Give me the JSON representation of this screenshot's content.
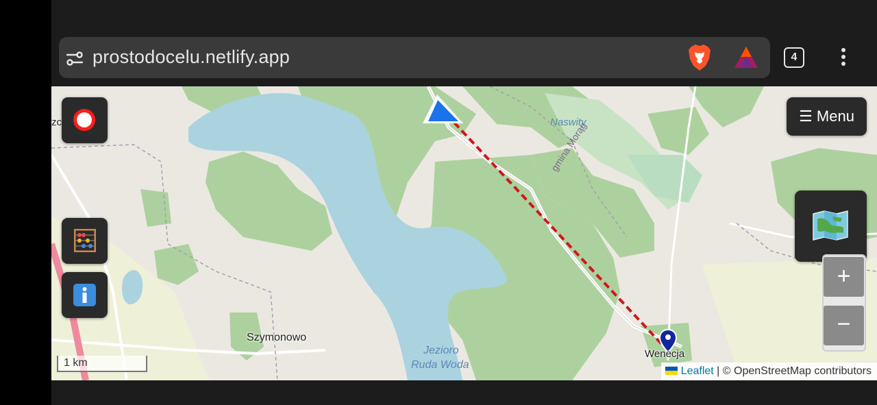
{
  "browser": {
    "url": "prostodocelu.netlify.app",
    "tab_count": "4",
    "icons": [
      "site-settings-icon",
      "brave-shields-icon",
      "brave-rewards-icon",
      "more-vertical-icon"
    ]
  },
  "map": {
    "menu_label": "☰ Menu",
    "zoom_in_label": "+",
    "zoom_out_label": "−",
    "scale_label": "1 km",
    "attribution_leaflet": "Leaflet",
    "attribution_rest": " | © OpenStreetMap contributors",
    "labels": {
      "szymonowo": "Szymonowo",
      "wenecja": "Wenecja",
      "naswity": "Naswity",
      "gmina": "gmina Morąg",
      "jezioro_line1": "Jezioro",
      "jezioro_line2": "Ruda Woda",
      "partial_left": "zcz"
    },
    "colors": {
      "route": "#d0161b",
      "navigation_arrow": "#1a73e8",
      "water": "#aad3df",
      "forest": "#add19e",
      "land": "#ebe8e2",
      "marker": "#1226a0"
    }
  }
}
